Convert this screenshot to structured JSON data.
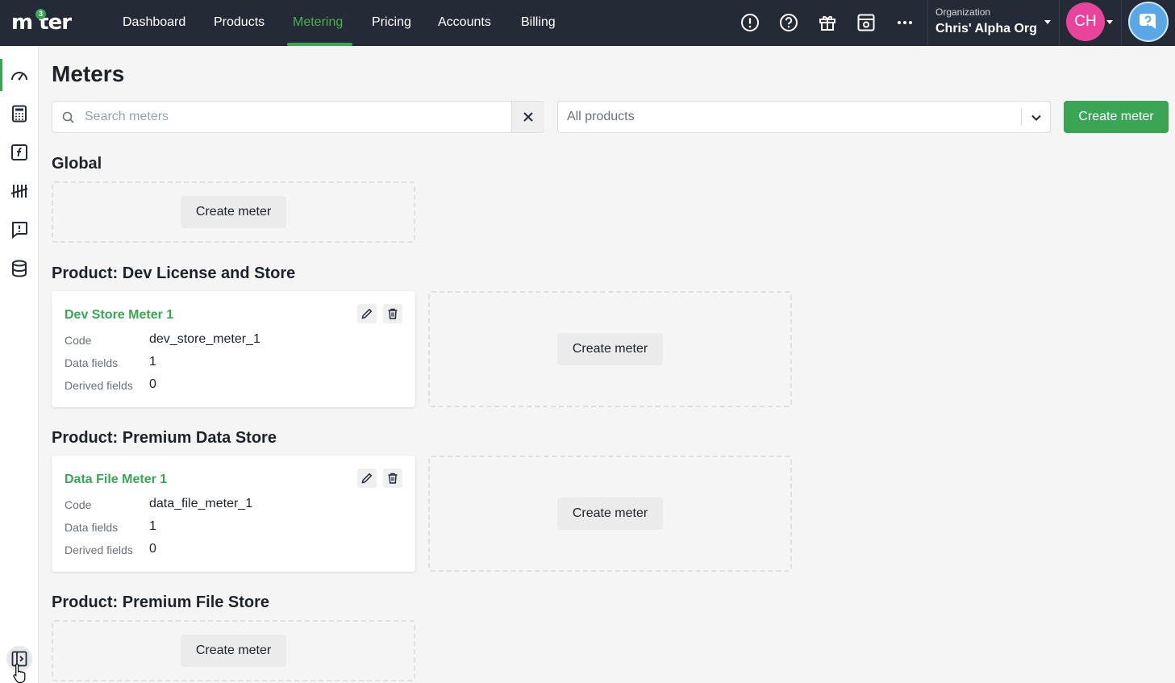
{
  "app": {
    "logo_text": "m ter",
    "logo_superscript": "3"
  },
  "nav": {
    "items": [
      "Dashboard",
      "Products",
      "Metering",
      "Pricing",
      "Accounts",
      "Billing"
    ],
    "active": "Metering"
  },
  "org": {
    "label": "Organization",
    "name": "Chris' Alpha Org"
  },
  "user": {
    "initials": "CH"
  },
  "page": {
    "title": "Meters"
  },
  "search": {
    "placeholder": "Search meters",
    "value": ""
  },
  "product_filter": {
    "value": "All products"
  },
  "create_meter_label": "Create meter",
  "sections": {
    "global": {
      "title": "Global"
    },
    "dev": {
      "title": "Product: Dev License and Store",
      "meter": {
        "name": "Dev Store Meter 1",
        "code": "dev_store_meter_1",
        "data_fields": "1",
        "derived_fields": "0"
      }
    },
    "premium_data": {
      "title": "Product: Premium Data Store",
      "meter": {
        "name": "Data File Meter 1",
        "code": "data_file_meter_1",
        "data_fields": "1",
        "derived_fields": "0"
      }
    },
    "premium_file": {
      "title": "Product: Premium File Store"
    }
  },
  "field_labels": {
    "code": "Code",
    "data_fields": "Data fields",
    "derived_fields": "Derived fields"
  },
  "colors": {
    "accent": "#3aa655",
    "topbar": "#252b36",
    "avatar": "#e9449b"
  }
}
